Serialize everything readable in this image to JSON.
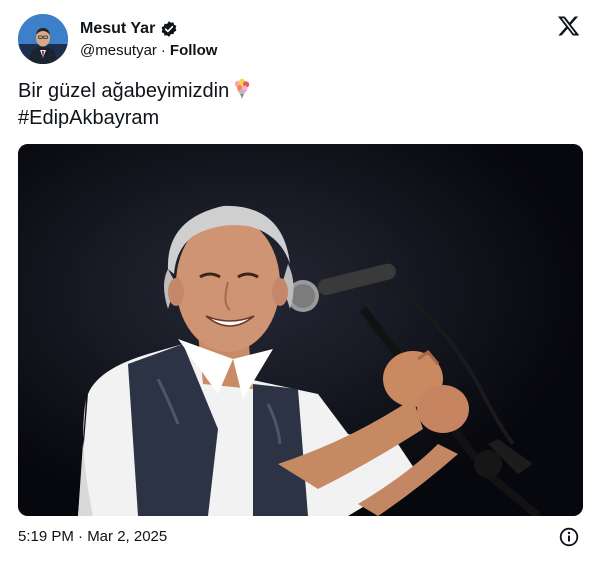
{
  "author": {
    "name": "Mesut Yar",
    "handle": "@mesutyar",
    "separator": "·",
    "follow_label": "Follow",
    "verified": true
  },
  "tweet": {
    "text_line1": "Bir güzel ağabeyimizdin",
    "text_line2": "#EdipAkbayram",
    "emoji": "bouquet-emoji"
  },
  "media": {
    "type": "photo"
  },
  "footer": {
    "timestamp": "5:19 PM · Mar 2, 2025"
  },
  "icons": {
    "brand": "x-logo-icon",
    "info": "info-icon",
    "verified": "verified-badge-icon"
  },
  "colors": {
    "text": "#0f1419",
    "background": "#ffffff"
  }
}
